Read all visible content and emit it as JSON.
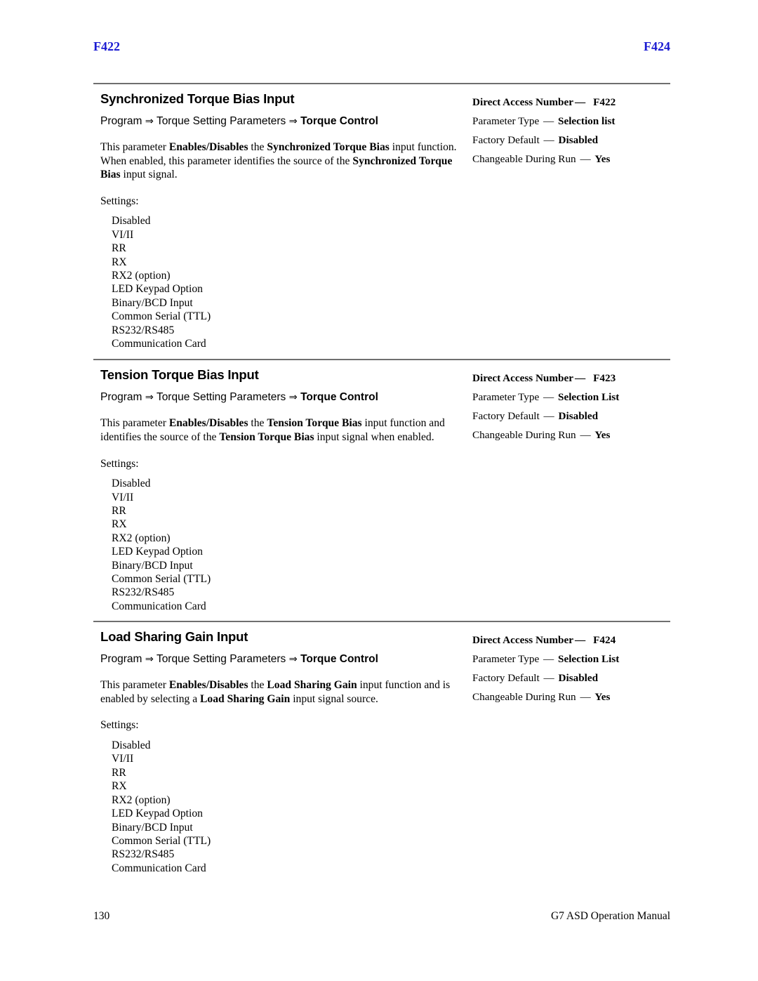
{
  "header": {
    "left_folio": "F422",
    "right_folio": "F424",
    "folio_color": "#1a1ad2"
  },
  "footer": {
    "page_number": "130",
    "manual_title": "G7 ASD Operation Manual"
  },
  "common": {
    "settings_label": "Settings:",
    "breadcrumb": {
      "part1": "Program",
      "arrow": "⇒",
      "part2": "Torque Setting Parameters",
      "part3": "Torque Control"
    },
    "settings_options": [
      "Disabled",
      "VI/II",
      "RR",
      "RX",
      "RX2 (option)",
      "LED Keypad Option",
      "Binary/BCD Input",
      "Common Serial (TTL)",
      "RS232/RS485",
      "Communication Card"
    ],
    "spec_labels": {
      "direct_access": "Direct Access Number",
      "parameter_type": "Parameter Type",
      "factory_default": "Factory Default",
      "changeable": "Changeable During Run"
    },
    "dash": "—"
  },
  "sections": [
    {
      "title": "Synchronized Torque Bias Input",
      "description": {
        "t1": "This parameter ",
        "b1": "Enables/Disables",
        "t2": " the ",
        "b2": "Synchronized Torque Bias",
        "t3": " input function. When enabled, this parameter identifies the source of the ",
        "b3": "Synchronized Torque Bias",
        "t4": " input signal."
      },
      "spec": {
        "direct_access_value": "F422",
        "parameter_type_value": "Selection list",
        "factory_default_value": "Disabled",
        "changeable_value": "Yes"
      }
    },
    {
      "title": "Tension Torque Bias Input",
      "description": {
        "t1": "This parameter ",
        "b1": "Enables/Disables",
        "t2": " the ",
        "b2": "Tension Torque Bias",
        "t3": " input function and identifies the source of the ",
        "b3": "Tension Torque Bias",
        "t4": " input signal when enabled."
      },
      "spec": {
        "direct_access_value": "F423",
        "parameter_type_value": "Selection List",
        "factory_default_value": "Disabled",
        "changeable_value": "Yes"
      }
    },
    {
      "title": "Load Sharing Gain Input",
      "description": {
        "t1": "This parameter ",
        "b1": "Enables/Disables",
        "t2": " the ",
        "b2": "Load Sharing Gain",
        "t3": " input function and is enabled by selecting a ",
        "b3": "Load Sharing Gain",
        "t4": " input signal source."
      },
      "spec": {
        "direct_access_value": "F424",
        "parameter_type_value": "Selection List",
        "factory_default_value": "Disabled",
        "changeable_value": "Yes"
      }
    }
  ]
}
